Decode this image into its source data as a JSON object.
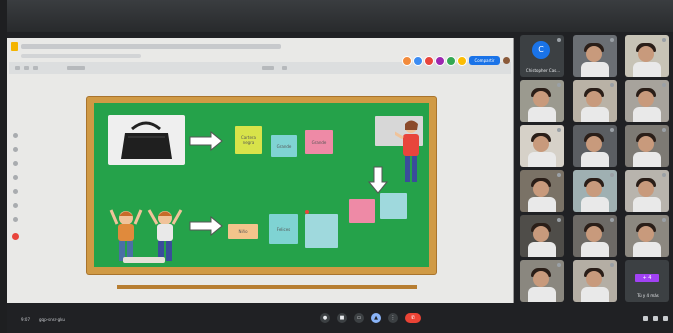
{
  "meet": {
    "meeting_time": "9:07",
    "meeting_code": "gqp-snsr-gku"
  },
  "editor": {
    "share_label": "Compartir",
    "presence_colors": [
      "#f28b3c",
      "#3c8cf2",
      "#e8453c",
      "#9c27b0",
      "#34a853",
      "#fbbc04"
    ]
  },
  "slide": {
    "cards": {
      "bag_adjectives": [
        "Cartera negra",
        "Grande",
        "Grande"
      ],
      "kids": [
        "Niño",
        "Felices",
        ""
      ],
      "teacher": [
        "",
        ""
      ]
    }
  },
  "participants": [
    {
      "kind": "avatar",
      "initial": "C",
      "name": "Chistopher Cas..."
    },
    {
      "kind": "video",
      "name": ""
    },
    {
      "kind": "video",
      "name": ""
    },
    {
      "kind": "video",
      "name": ""
    },
    {
      "kind": "video",
      "name": ""
    },
    {
      "kind": "video",
      "name": ""
    },
    {
      "kind": "video",
      "name": ""
    },
    {
      "kind": "video",
      "name": ""
    },
    {
      "kind": "video",
      "name": ""
    },
    {
      "kind": "video",
      "name": ""
    },
    {
      "kind": "video",
      "name": ""
    },
    {
      "kind": "video",
      "name": ""
    },
    {
      "kind": "video",
      "name": ""
    },
    {
      "kind": "video",
      "name": ""
    },
    {
      "kind": "video",
      "name": ""
    },
    {
      "kind": "video",
      "name": ""
    },
    {
      "kind": "video",
      "name": ""
    },
    {
      "kind": "video",
      "name": ""
    },
    {
      "kind": "others",
      "badge": "+ 4",
      "name": "Tú y 4 más"
    }
  ]
}
